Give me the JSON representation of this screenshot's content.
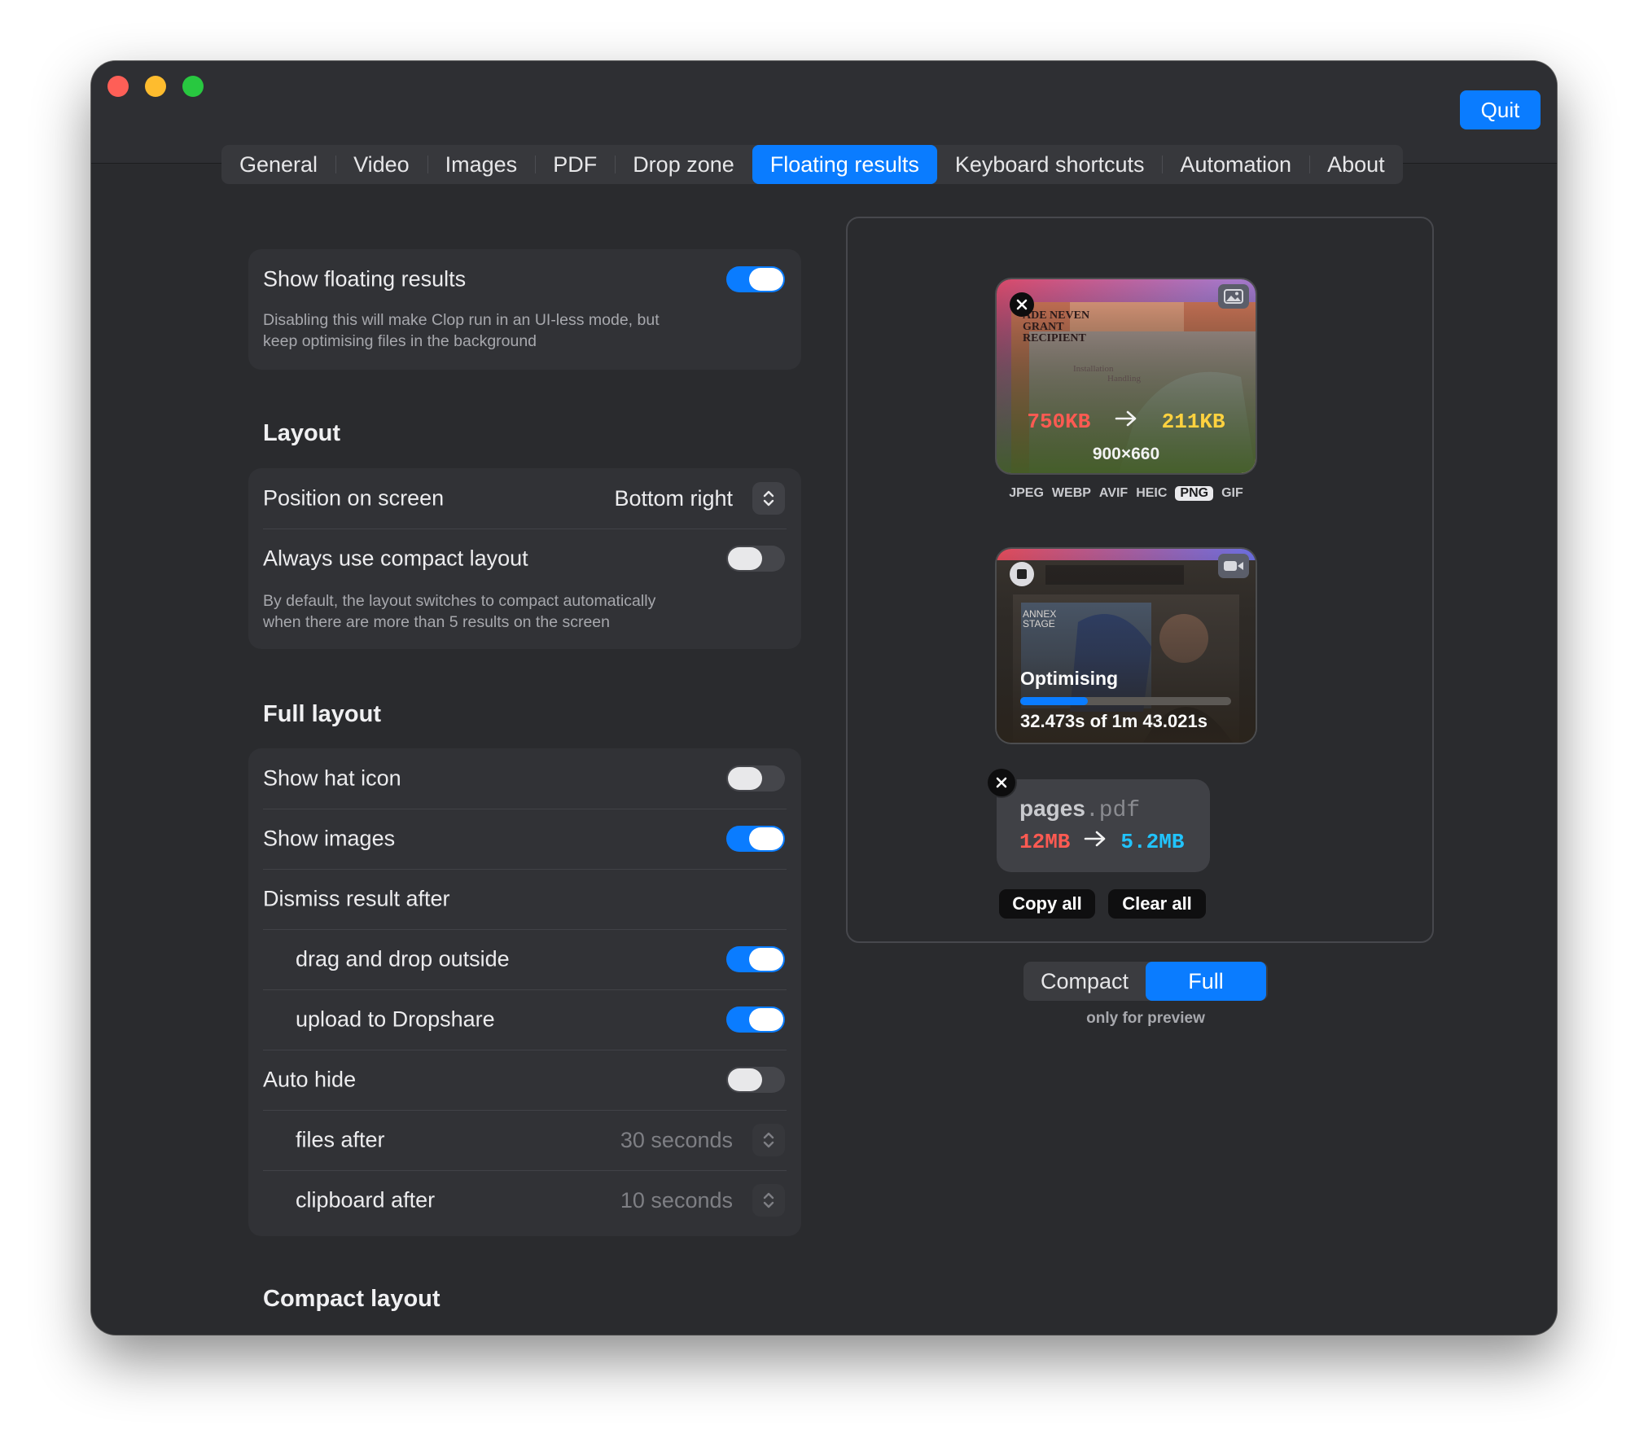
{
  "window": {
    "quit_label": "Quit"
  },
  "tabs": [
    {
      "label": "General"
    },
    {
      "label": "Video"
    },
    {
      "label": "Images"
    },
    {
      "label": "PDF"
    },
    {
      "label": "Drop zone"
    },
    {
      "label": "Floating results",
      "active": true
    },
    {
      "label": "Keyboard shortcuts"
    },
    {
      "label": "Automation"
    },
    {
      "label": "About"
    }
  ],
  "settings": {
    "show_floating": {
      "label": "Show floating results",
      "on": true,
      "description_line1": "Disabling this will make Clop run in an UI-less mode, but",
      "description_line2": "keep optimising files in the background"
    },
    "layout": {
      "title": "Layout",
      "position_label": "Position on screen",
      "position_value": "Bottom right",
      "compact_label": "Always use compact layout",
      "compact_on": false,
      "compact_desc_line1": "By default, the layout switches to compact automatically",
      "compact_desc_line2": "when there are more than 5 results on the screen"
    },
    "full_layout": {
      "title": "Full layout",
      "show_hat_icon": {
        "label": "Show hat icon",
        "on": false
      },
      "show_images": {
        "label": "Show images",
        "on": true
      },
      "dismiss_label": "Dismiss result after",
      "drag_drop": {
        "label": "drag and drop outside",
        "on": true
      },
      "upload": {
        "label": "upload to Dropshare",
        "on": true
      },
      "auto_hide": {
        "label": "Auto hide",
        "on": false
      },
      "files_after": {
        "label": "files after",
        "value": "30 seconds"
      },
      "clipboard_after": {
        "label": "clipboard after",
        "value": "10 seconds"
      }
    },
    "compact_layout_title": "Compact layout"
  },
  "preview": {
    "image_result": {
      "size_before": "750KB",
      "size_after": "211KB",
      "dimensions": "900×660",
      "formats": [
        "JPEG",
        "WEBP",
        "AVIF",
        "HEIC",
        "PNG",
        "GIF"
      ],
      "selected_format": "PNG",
      "thumb_text": [
        "ADE NEVEN",
        "GRANT",
        "RECIPIENT",
        "Installation",
        "Handling"
      ]
    },
    "video_result": {
      "status": "Optimising",
      "progress": 0.32,
      "progress_text": "32.473s of 1m 43.021s",
      "thumb_text": [
        "ANNEX",
        "STAGE"
      ]
    },
    "pdf_result": {
      "name": "pages",
      "ext": ".pdf",
      "size_before": "12MB",
      "size_after": "5.2MB"
    },
    "copy_all": "Copy all",
    "clear_all": "Clear all",
    "modes": [
      "Compact",
      "Full"
    ],
    "active_mode": "Full",
    "note": "only for preview"
  },
  "colors": {
    "accent": "#0a7cff",
    "size_before": "#ff5a52",
    "size_after_image": "#ffd23f",
    "size_after_pdf": "#21c4ff",
    "window_bg": "#2a2b2e"
  }
}
